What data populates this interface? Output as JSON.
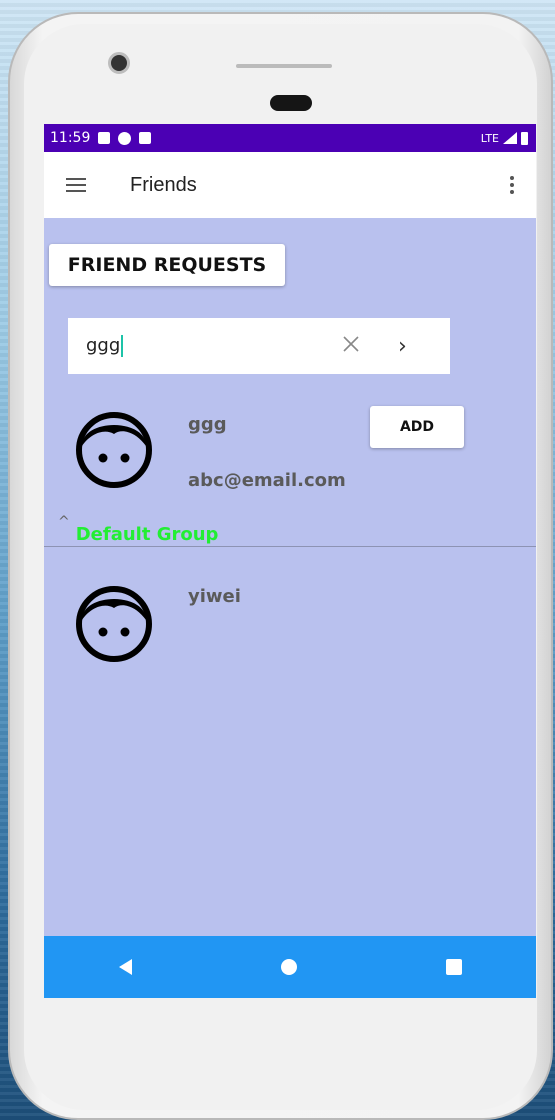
{
  "status_bar": {
    "time": "11:59",
    "network": "LTE"
  },
  "app_bar": {
    "title": "Friends"
  },
  "friend_requests_button": {
    "label": "FRIEND REQUESTS"
  },
  "search": {
    "value": "ggg"
  },
  "search_result": {
    "name": "ggg",
    "email": "abc@email.com",
    "add_label": "ADD"
  },
  "group": {
    "name": "Default Group",
    "expanded": true
  },
  "friends": [
    {
      "name": "yiwei"
    }
  ],
  "colors": {
    "status_bar": "#4b00b4",
    "background": "#b9c1ee",
    "group_label": "#22ee33",
    "nav_bar": "#2196f3"
  },
  "icons": [
    "menu-icon",
    "more-vert-icon",
    "clear-icon",
    "chevron-right-icon",
    "face-icon",
    "chevron-up-icon",
    "back-icon",
    "home-icon",
    "recent-apps-icon"
  ]
}
